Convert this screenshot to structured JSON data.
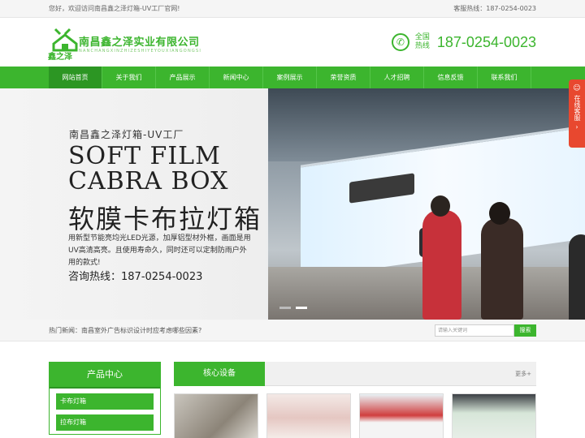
{
  "topbar": {
    "welcome": "您好，欢迎访问南昌鑫之泽灯箱-UV工厂官网!",
    "service_hotline": "客服热线：187-0254-0023"
  },
  "header": {
    "logo_text": "鑫之泽",
    "company_name": "南昌鑫之泽实业有限公司",
    "company_en": "NANCHANGXINZHIZESHIYEYOUXIANGONGSI",
    "hotline_label": "全国热线",
    "hotline_number": "187-0254-0023"
  },
  "nav": {
    "items": [
      "网站首页",
      "关于我们",
      "产品展示",
      "新闻中心",
      "案例展示",
      "荣誉资质",
      "人才招聘",
      "信息反馈",
      "联系我们"
    ],
    "active_index": 0
  },
  "banner": {
    "subtitle": "南昌鑫之泽灯箱-UV工厂",
    "title_en_1": "SOFT FILM",
    "title_en_2": "CABRA BOX",
    "title_cn": "软膜卡布拉灯箱",
    "description": "用新型节能亮均光LED光源，加厚铝型材外框，画面是用UV高清高亮。且使用寿命久，同时还可以定制防雨户外用的款式!",
    "tel": "咨询热线：187-0254-0023",
    "slides": 2,
    "active_slide": 1
  },
  "side_service": {
    "label": "在线客服"
  },
  "hot_news": {
    "text": "热门新闻：南昌室外广告标识设计时应考虑哪些因素?"
  },
  "search": {
    "placeholder": "请输入关键词",
    "button": "搜索"
  },
  "products": {
    "title": "产品中心",
    "items": [
      "卡布灯箱",
      "拉布灯箱"
    ]
  },
  "core_equipment": {
    "title": "核心设备",
    "more": "更多+"
  },
  "colors": {
    "brand_green": "#3cb52e",
    "dark_green": "#2c9623",
    "service_red": "#e8482f"
  }
}
